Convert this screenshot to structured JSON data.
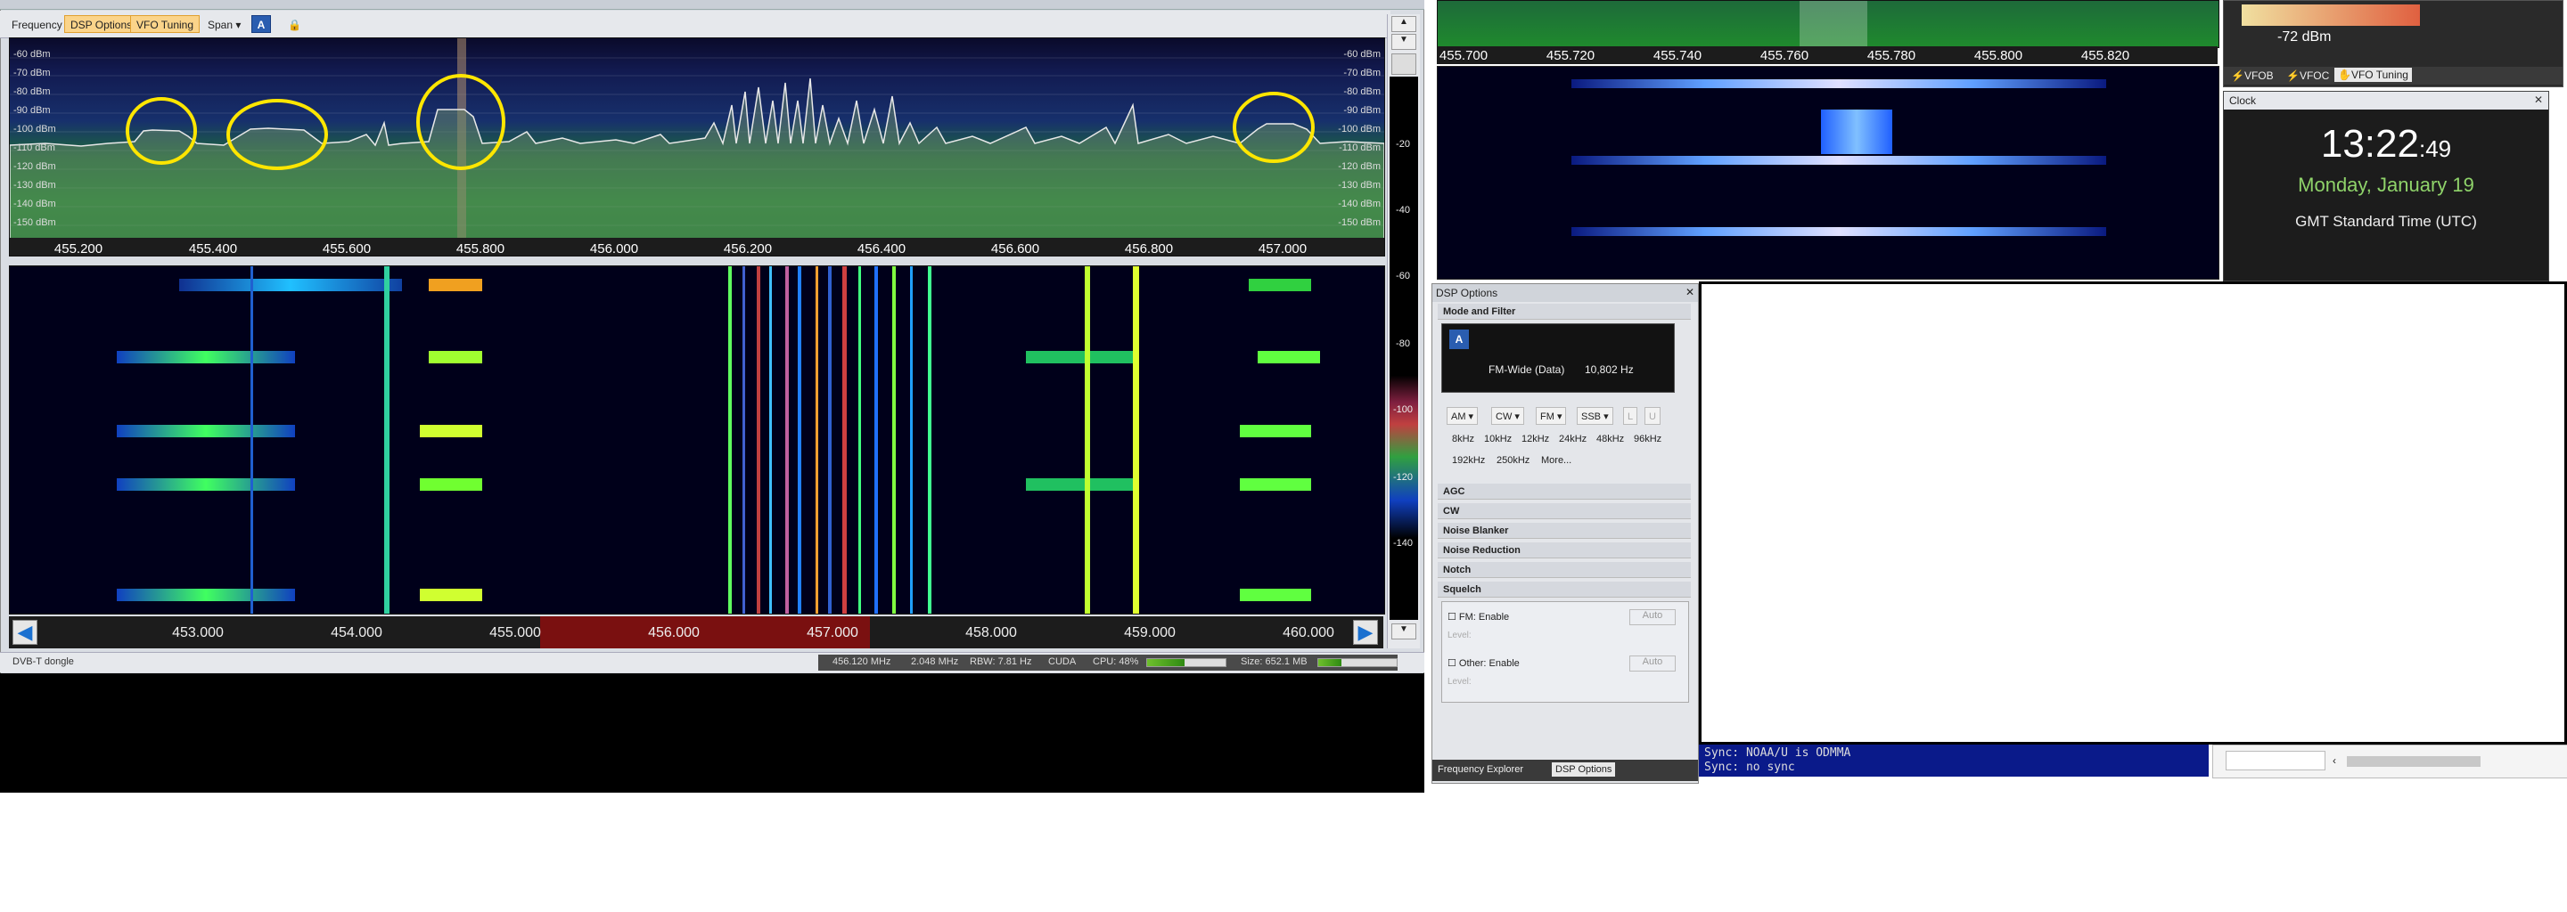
{
  "toolbar": {
    "tabs": [
      "Frequency",
      "DSP Options",
      "VFO Tuning"
    ],
    "span_label": "Span",
    "a_label": "A"
  },
  "spectrum": {
    "db_labels": [
      "-60 dBm",
      "-70 dBm",
      "-80 dBm",
      "-90 dBm",
      "-100 dBm",
      "-110 dBm",
      "-120 dBm",
      "-130 dBm",
      "-140 dBm",
      "-150 dBm"
    ],
    "freq_labels": [
      "455.200",
      "455.400",
      "455.600",
      "455.800",
      "456.000",
      "456.200",
      "456.400",
      "456.600",
      "456.800",
      "457.000"
    ]
  },
  "waterfall": {
    "scale_labels": [
      "453.000",
      "454.000",
      "455.000",
      "456.000",
      "457.000",
      "458.000",
      "459.000",
      "460.000"
    ]
  },
  "right_strip": {
    "labels": [
      "-20",
      "-40",
      "-60",
      "-80",
      "-100",
      "-120",
      "-140"
    ]
  },
  "status": {
    "device": "DVB-T dongle",
    "center_freq": "456.120 MHz",
    "sample_rate": "2.048 MHz",
    "rbw": "RBW: 7.81 Hz",
    "backend": "CUDA",
    "cpu": "CPU: 48%",
    "cpu_level": 0.48,
    "size": "Size: 652.1 MB",
    "size_level": 0.3
  },
  "small_spectrum": {
    "freq_labels": [
      "455.700",
      "455.720",
      "455.740",
      "455.760",
      "455.780",
      "455.800",
      "455.820"
    ]
  },
  "vfo": {
    "level": "-72 dBm",
    "tabs": [
      "VFOB",
      "VFOC",
      "VFO Tuning"
    ]
  },
  "clock": {
    "title": "Clock",
    "time_hm": "13:22",
    "time_s": ":49",
    "date": "Monday, January 19",
    "zone": "GMT Standard Time (UTC)"
  },
  "dsp": {
    "title": "DSP Options",
    "section_mode": "Mode and Filter",
    "mode_name": "FM-Wide (Data)",
    "bandwidth": "10,802 Hz",
    "modes": [
      "AM",
      "CW",
      "FM",
      "SSB",
      "L",
      "U"
    ],
    "bw_row1": [
      "8kHz",
      "10kHz",
      "12kHz",
      "24kHz",
      "48kHz",
      "96kHz"
    ],
    "bw_row2": [
      "192kHz",
      "250kHz",
      "More..."
    ],
    "sections": [
      "AGC",
      "CW",
      "Noise Blanker",
      "Noise Reduction",
      "Notch",
      "Squelch"
    ],
    "fm_enable": "FM: Enable",
    "other_enable": "Other: Enable",
    "auto": "Auto",
    "level": "Level:",
    "bottom_tabs": [
      "Frequency Explorer",
      "DSP Options"
    ]
  },
  "console": {
    "line1": "Sync: NOAA/U is ODMMA",
    "line2": "Sync: no sync"
  },
  "colors": {
    "accent_tab": "#fbd48a",
    "circle": "#ffe600",
    "time_green": "#8fd36a"
  }
}
